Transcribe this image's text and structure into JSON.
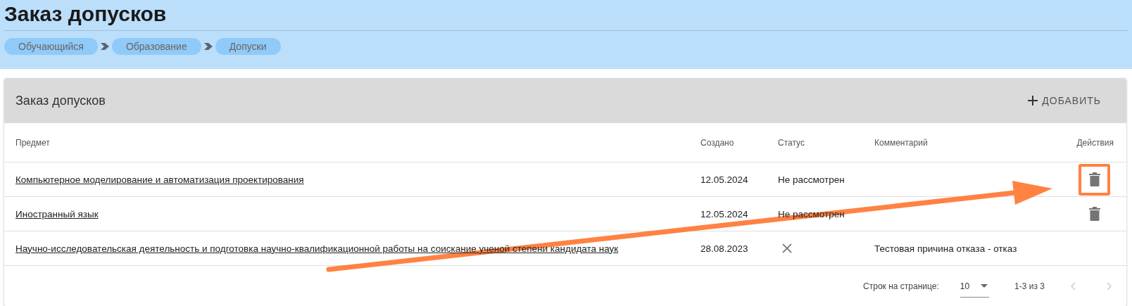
{
  "page": {
    "title": "Заказ допусков"
  },
  "breadcrumbs": [
    {
      "label": "Обучающийся"
    },
    {
      "label": "Образование"
    },
    {
      "label": "Допуски"
    }
  ],
  "card": {
    "title": "Заказ допусков",
    "add_button": "ДОБАВИТЬ"
  },
  "table": {
    "columns": [
      "Предмет",
      "Создано",
      "Статус",
      "Комментарий",
      "Действия"
    ],
    "rows": [
      {
        "subject": "Компьютерное моделирование и автоматизация проектирования",
        "created": "12.05.2024",
        "status": "Не рассмотрен",
        "rejected": false,
        "deletable": true,
        "highlighted": true
      },
      {
        "subject": "Иностранный язык",
        "created": "12.05.2024",
        "status": "Не рассмотрен",
        "rejected": false,
        "deletable": true,
        "highlighted": false
      },
      {
        "subject": "Научно-исследовательская деятельность и подготовка научно-квалификационной работы на соискание ученой степени кандидата наук",
        "created": "28.08.2023",
        "rejected": true,
        "comment": "Тестовая причина отказа - отказ",
        "deletable": false,
        "highlighted": false
      }
    ]
  },
  "pagination": {
    "rows_label": "Строк на странице:",
    "rows_per_page": "10",
    "range": "1-3 из 3",
    "prev_disabled": true,
    "next_disabled": true
  }
}
